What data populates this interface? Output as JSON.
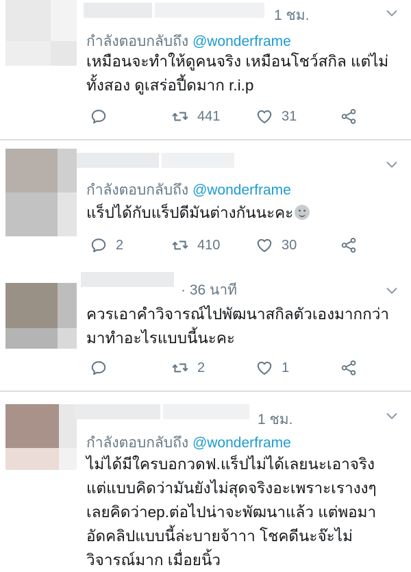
{
  "tweets": [
    {
      "time": "1 ชม.",
      "reply_prefix": "กำลังตอบกลับถึง",
      "reply_handle": "@wonderframe",
      "lines": [
        "เหมือนจะทำให้ดูคนจริง เหมือนโชว์สกิล แต่ไม่",
        "ทั้งสอง ดูเสร่อปี้ดมาก r.i.p"
      ],
      "replies": "",
      "retweets": "441",
      "likes": "31"
    },
    {
      "time": "",
      "reply_prefix": "กำลังตอบกลับถึง",
      "reply_handle": "@wonderframe",
      "lines": [
        "แร็ปได้กับแร็ปดีมันต่างกันนะคะ"
      ],
      "replies": "2",
      "retweets": "410",
      "likes": "30"
    },
    {
      "time": "· 36 นาที",
      "lines": [
        "ควรเอาคำวิจารณ์ไปพัฒนาสกิลตัวเองมากกว่า",
        "มาทำอะไรแบบนี้นะคะ"
      ],
      "replies": "",
      "retweets": "2",
      "likes": "1"
    },
    {
      "time": "1 ชม.",
      "reply_prefix": "กำลังตอบกลับถึง",
      "reply_handle": "@wonderframe",
      "lines": [
        "ไม่ได้มีใครบอกวดฟ.แร็ปไม่ได้เลยนะเอาจริง",
        "แต่แบบคิดว่ามันยังไม่สุดจริงอะเพราะเรางงๆ",
        "เลยคิดว่าep.ต่อไปน่าจะพัฒนาแล้ว แต่พอมา",
        "อัดคลิปแบบนี้ล่ะบายจ้าาา  โชคดีนะจ๊ะไม่",
        "วิจารณ์มาก เมื่อยนิ้ว"
      ]
    }
  ],
  "colors": {
    "text": "#14171a",
    "secondary": "#657786",
    "link": "#1d9bd1",
    "divider": "#d8dde1"
  },
  "icons": [
    "reply-icon",
    "retweet-icon",
    "like-icon",
    "share-icon",
    "chevron-down-icon",
    "emoji-icon"
  ]
}
